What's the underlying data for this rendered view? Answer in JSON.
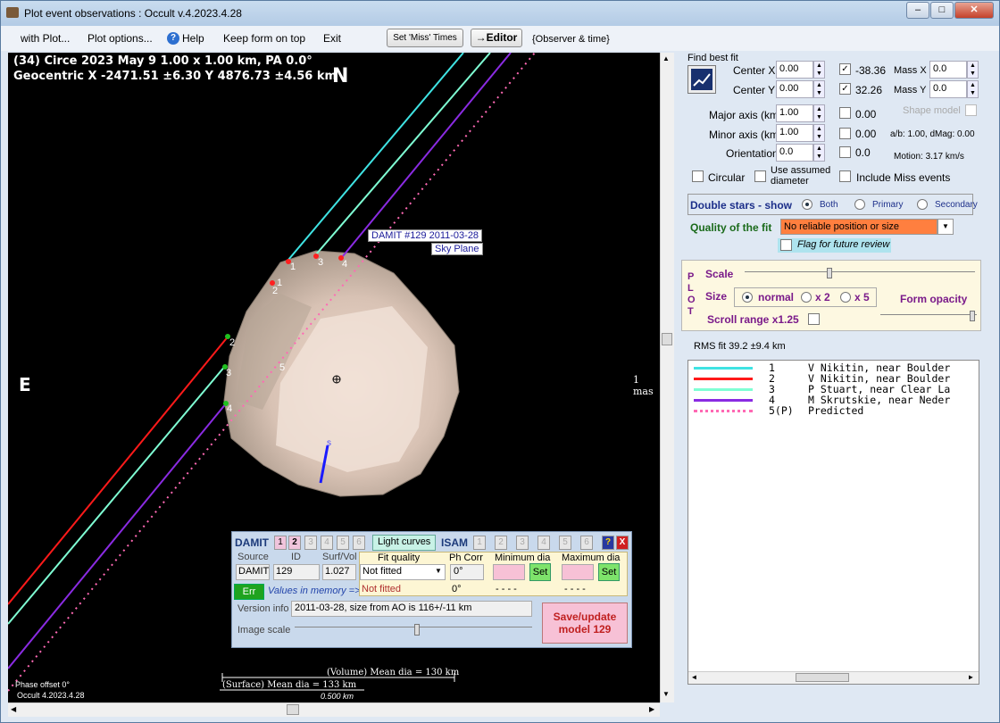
{
  "window": {
    "title": "Plot event observations : Occult v.4.2023.4.28",
    "controls": [
      "–",
      "□",
      "✕"
    ]
  },
  "menu": {
    "with_plot": "with Plot...",
    "plot_options": "Plot options...",
    "help": "Help",
    "keep_on_top": "Keep form on top",
    "exit": "Exit",
    "set_miss_times": "Set 'Miss' Times",
    "editor": "→Editor",
    "observer_time": "{Observer & time}"
  },
  "plot": {
    "header_line1": "(34) Circe  2023 May 9   1.00 x 1.00 km,  PA 0.0°",
    "header_line2": "Geocentric  X  -2471.51 ±6.30  Y 4876.73 ±4.56 km",
    "north": "N",
    "east": "E",
    "scale_mas": "1 mas",
    "damit_label": "DAMIT #129 2011-03-28",
    "sky_plane": "Sky Plane",
    "phase_offset": "Phase offset 0°",
    "version": "Occult 4.2023.4.28",
    "volume_dia": "(Volume) Mean dia = 130 km",
    "surface_dia": "(Surface) Mean dia = 133 km",
    "scale_km": "0.500 km",
    "chord_labels": [
      "1",
      "3",
      "4",
      "1",
      "2",
      "2",
      "3",
      "4",
      "5"
    ],
    "spin_label": "s"
  },
  "damit": {
    "title": "DAMIT",
    "tabs": [
      "1",
      "2",
      "3",
      "4",
      "5",
      "6"
    ],
    "light_curves": "Light curves",
    "isam": "ISAM",
    "isam_tabs": [
      "1",
      "2",
      "3",
      "4",
      "5",
      "6"
    ],
    "help": "?",
    "close": "X",
    "source_label": "Source",
    "id_label": "ID",
    "surfvol_label": "Surf/Vol",
    "source": "DAMIT",
    "id": "129",
    "surfvol": "1.027",
    "fit_quality_label": "Fit quality",
    "ph_corr_label": "Ph Corr",
    "min_dia_label": "Minimum dia",
    "max_dia_label": "Maximum dia",
    "fit_quality": "Not fitted",
    "ph_corr": "0°",
    "set": "Set",
    "values_in_memory": "Values in memory =>",
    "mem_fit": "Not fitted",
    "mem_ph": "0°",
    "mem_min": "- - - -",
    "mem_max": "- - - -",
    "err": "Err",
    "version_info_label": "Version info",
    "version_info": "2011-03-28, size from AO is 116+/-11 km",
    "image_scale_label": "Image scale",
    "save_update": "Save/update model 129"
  },
  "fit": {
    "find_best_fit": "Find best fit",
    "center_x_label": "Center X",
    "center_x": "0.00",
    "center_x_result": "-38.36",
    "center_y_label": "Center Y",
    "center_y": "0.00",
    "center_y_result": "32.26",
    "mass_x_label": "Mass X",
    "mass_x": "0.0",
    "mass_y_label": "Mass Y",
    "mass_y": "0.0",
    "major_label": "Major axis (km)",
    "major": "1.00",
    "major_result": "0.00",
    "minor_label": "Minor axis (km)",
    "minor": "1.00",
    "minor_result": "0.00",
    "orient_label": "Orientation",
    "orient": "0.0",
    "orient_result": "0.0",
    "shape_model": "Shape model",
    "ab_dmag": "a/b: 1.00, dMag: 0.00",
    "motion": "Motion: 3.17 km/s",
    "circular": "Circular",
    "use_assumed": "Use assumed diameter",
    "include_miss": "Include Miss events"
  },
  "double_stars": {
    "label": "Double stars - show",
    "both": "Both",
    "primary": "Primary",
    "secondary": "Secondary"
  },
  "quality": {
    "label": "Quality of the fit",
    "value": "No reliable position or size",
    "flag": "Flag for future review"
  },
  "plot_panel": {
    "letters": [
      "P",
      "L",
      "O",
      "T"
    ],
    "scale": "Scale",
    "size": "Size",
    "normal": "normal",
    "x2": "x 2",
    "x5": "x 5",
    "form_opacity": "Form opacity",
    "scroll_range": "Scroll range x1.25"
  },
  "rms_fit": "RMS fit 39.2 ±9.4 km",
  "legend": [
    {
      "num": "1",
      "text": "V Nikitin, near Boulder",
      "color": "#3fe3e3",
      "style": "solid"
    },
    {
      "num": "2",
      "text": "V Nikitin, near Boulder",
      "color": "#ff1a1a",
      "style": "solid"
    },
    {
      "num": "3",
      "text": "P Stuart, near Clear La",
      "color": "#7fffd4",
      "style": "solid"
    },
    {
      "num": "4",
      "text": "M Skrutskie, near Neder",
      "color": "#8a2be2",
      "style": "solid"
    },
    {
      "num": "5(P)",
      "text": "Predicted",
      "color": "#ff69b4",
      "style": "dotted"
    }
  ]
}
